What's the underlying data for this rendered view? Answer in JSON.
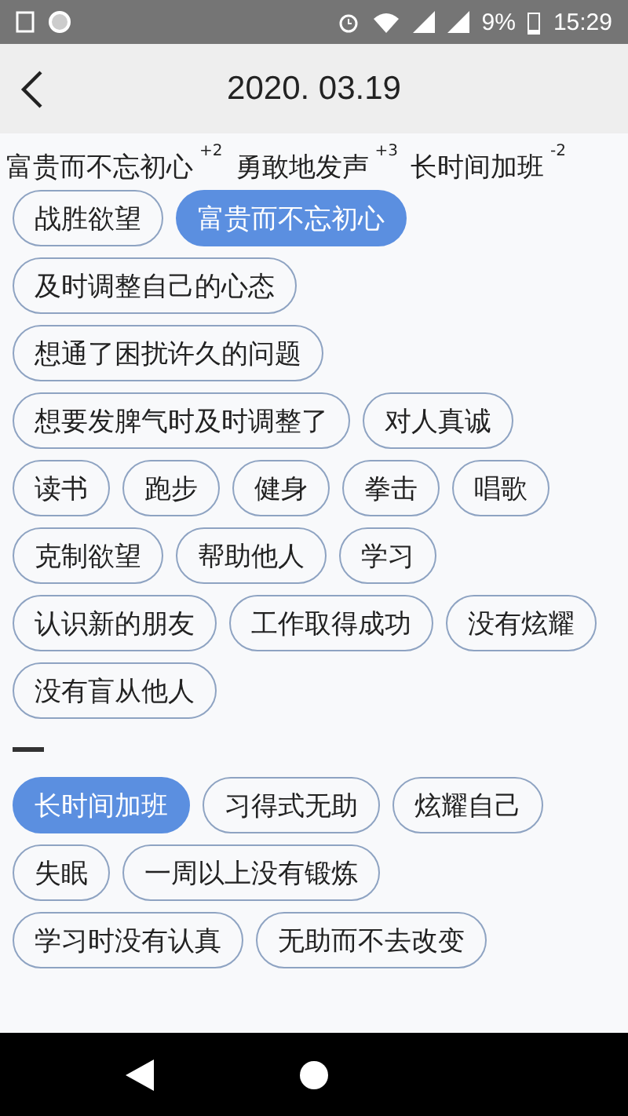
{
  "status_bar": {
    "battery": "9%",
    "time": "15:29"
  },
  "header": {
    "title": "2020. 03.19"
  },
  "summary": [
    {
      "label": "富贵而不忘初心",
      "score": "+2"
    },
    {
      "label": "勇敢地发声",
      "score": "+3"
    },
    {
      "label": "长时间加班",
      "score": "-2"
    }
  ],
  "groups": [
    {
      "tags": [
        {
          "label": "战胜欲望",
          "selected": false
        },
        {
          "label": "富贵而不忘初心",
          "selected": true
        },
        {
          "label": "及时调整自己的心态",
          "selected": false
        },
        {
          "label": "想通了困扰许久的问题",
          "selected": false
        },
        {
          "label": "想要发脾气时及时调整了",
          "selected": false
        },
        {
          "label": "对人真诚",
          "selected": false
        },
        {
          "label": "读书",
          "selected": false
        },
        {
          "label": "跑步",
          "selected": false
        },
        {
          "label": "健身",
          "selected": false
        },
        {
          "label": "拳击",
          "selected": false
        },
        {
          "label": "唱歌",
          "selected": false
        },
        {
          "label": "克制欲望",
          "selected": false
        },
        {
          "label": "帮助他人",
          "selected": false
        },
        {
          "label": "学习",
          "selected": false
        },
        {
          "label": "认识新的朋友",
          "selected": false
        },
        {
          "label": "工作取得成功",
          "selected": false
        },
        {
          "label": "没有炫耀",
          "selected": false
        },
        {
          "label": "没有盲从他人",
          "selected": false
        }
      ]
    },
    {
      "tags": [
        {
          "label": "长时间加班",
          "selected": true
        },
        {
          "label": "习得式无助",
          "selected": false
        },
        {
          "label": "炫耀自己",
          "selected": false
        },
        {
          "label": "失眠",
          "selected": false
        },
        {
          "label": "一周以上没有锻炼",
          "selected": false
        },
        {
          "label": "学习时没有认真",
          "selected": false
        },
        {
          "label": "无助而不去改变",
          "selected": false
        }
      ]
    }
  ]
}
